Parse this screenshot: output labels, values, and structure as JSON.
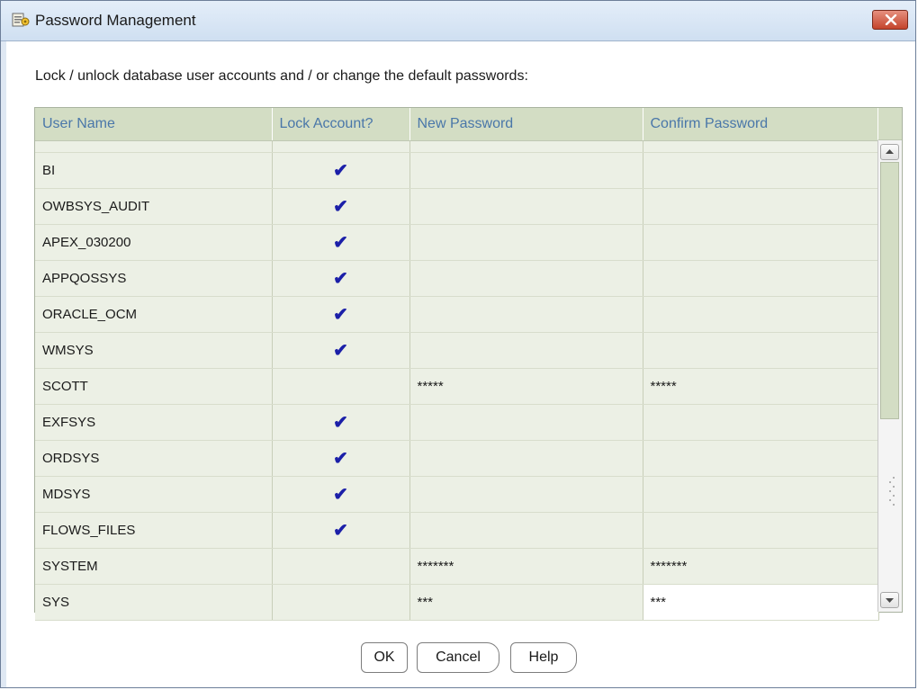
{
  "window": {
    "title": "Password Management",
    "icon": "db-config-icon",
    "close_icon": "close-x-icon"
  },
  "instruction": "Lock / unlock database user accounts and / or change the default passwords:",
  "table": {
    "columns": [
      "User Name",
      "Lock Account?",
      "New Password",
      "Confirm Password"
    ],
    "rows": [
      {
        "user": "BI",
        "locked": true,
        "new_password": "",
        "confirm_password": ""
      },
      {
        "user": "OWBSYS_AUDIT",
        "locked": true,
        "new_password": "",
        "confirm_password": ""
      },
      {
        "user": "APEX_030200",
        "locked": true,
        "new_password": "",
        "confirm_password": ""
      },
      {
        "user": "APPQOSSYS",
        "locked": true,
        "new_password": "",
        "confirm_password": ""
      },
      {
        "user": "ORACLE_OCM",
        "locked": true,
        "new_password": "",
        "confirm_password": ""
      },
      {
        "user": "WMSYS",
        "locked": true,
        "new_password": "",
        "confirm_password": ""
      },
      {
        "user": "SCOTT",
        "locked": false,
        "new_password": "*****",
        "confirm_password": "*****"
      },
      {
        "user": "EXFSYS",
        "locked": true,
        "new_password": "",
        "confirm_password": ""
      },
      {
        "user": "ORDSYS",
        "locked": true,
        "new_password": "",
        "confirm_password": ""
      },
      {
        "user": "MDSYS",
        "locked": true,
        "new_password": "",
        "confirm_password": ""
      },
      {
        "user": "FLOWS_FILES",
        "locked": true,
        "new_password": "",
        "confirm_password": ""
      },
      {
        "user": "SYSTEM",
        "locked": false,
        "new_password": "*******",
        "confirm_password": "*******"
      },
      {
        "user": "SYS",
        "locked": false,
        "new_password": "***",
        "confirm_password": "***"
      }
    ],
    "check_glyph": "✔"
  },
  "buttons": {
    "ok": "OK",
    "cancel": "Cancel",
    "help": "Help"
  },
  "colors": {
    "header_bg": "#d3ddc4",
    "header_text": "#4a77a9",
    "row_bg": "#ecf0e5",
    "check": "#1b1fa8",
    "close_button": "#c4442c"
  }
}
